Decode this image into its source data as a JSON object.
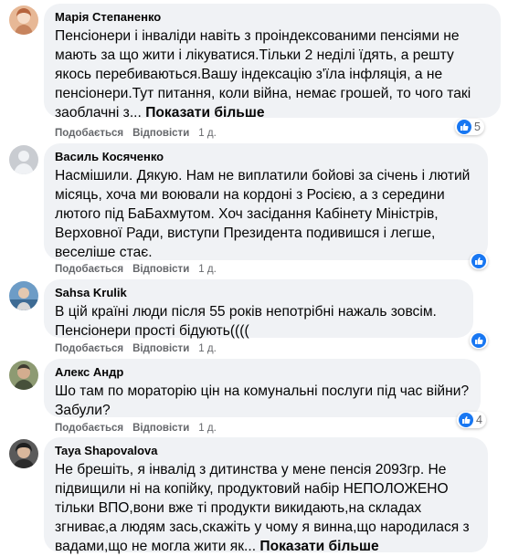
{
  "comments": [
    {
      "author": "Марія Степаненко",
      "text": "Пенсіонери і інваліди навіть з проіндексованими пенсіями не мають за що жити і лікуватися.Тільки 2 неділі їдять, а решту якось перебиваються.Вашу індексацію з'їла інфляція, а не пенсіонери.Тут питання, коли війна, немає грошей, то чого такі заоблачні з...",
      "more": "Показати більше",
      "like": "Подобається",
      "reply": "Відповісти",
      "time": "1 д.",
      "reactions": "5",
      "avatar_colors": [
        "#e2a27c",
        "#f4d9c6"
      ]
    },
    {
      "author": "Василь Косяченко",
      "text": "Насмішили. Дякую. Нам не виплатили бойові за січень і лютий місяць, хоча ми воювали на кордоні з Росією, а з середини лютого під БаБахмутом. Хоч засідання Кабінету Міністрів, Верховної Ради, виступи Президента подивишся і легше, веселіше стає.",
      "more": "",
      "like": "Подобається",
      "reply": "Відповісти",
      "time": "1 д.",
      "reactions": "",
      "avatar_colors": [
        "#c9ccd1",
        "#e4e6eb"
      ]
    },
    {
      "author": "Sahsa Krulik",
      "text": "В цій країні люди після 55 років непотрібні нажаль зовсім. Пенсіонери прості бідують((((",
      "more": "",
      "like": "Подобається",
      "reply": "Відповісти",
      "time": "1 д.",
      "reactions": "",
      "avatar_colors": [
        "#4f7ca8",
        "#9fc0dc"
      ]
    },
    {
      "author": "Алекс Андр",
      "text": "Шо там по мораторію цін на комунальні послуги під час війни? Забули?",
      "more": "",
      "like": "Подобається",
      "reply": "Відповісти",
      "time": "1 д.",
      "reactions": "4",
      "avatar_colors": [
        "#6a7a55",
        "#a9b48d"
      ]
    },
    {
      "author": "Taya Shapovalova",
      "text": "Не брешіть, я інвалід з дитинства у мене пенсія 2093гр. Не підвищили ні на копійку, продуктовий набір НЕПОЛОЖЕНО тільки ВПО,вони вже ті продукти викидають,на складах згниває,а людям зась,скажіть у чому я винна,що народилася з вадами,що не могла жити як...",
      "more": "Показати більше",
      "like": "",
      "reply": "",
      "time": "",
      "reactions": "",
      "avatar_colors": [
        "#3b3b3b",
        "#7d7d7d"
      ]
    }
  ],
  "colors": {
    "bubble": "#f0f2f5",
    "muted": "#65676b",
    "like_blue": "#1877f2"
  }
}
